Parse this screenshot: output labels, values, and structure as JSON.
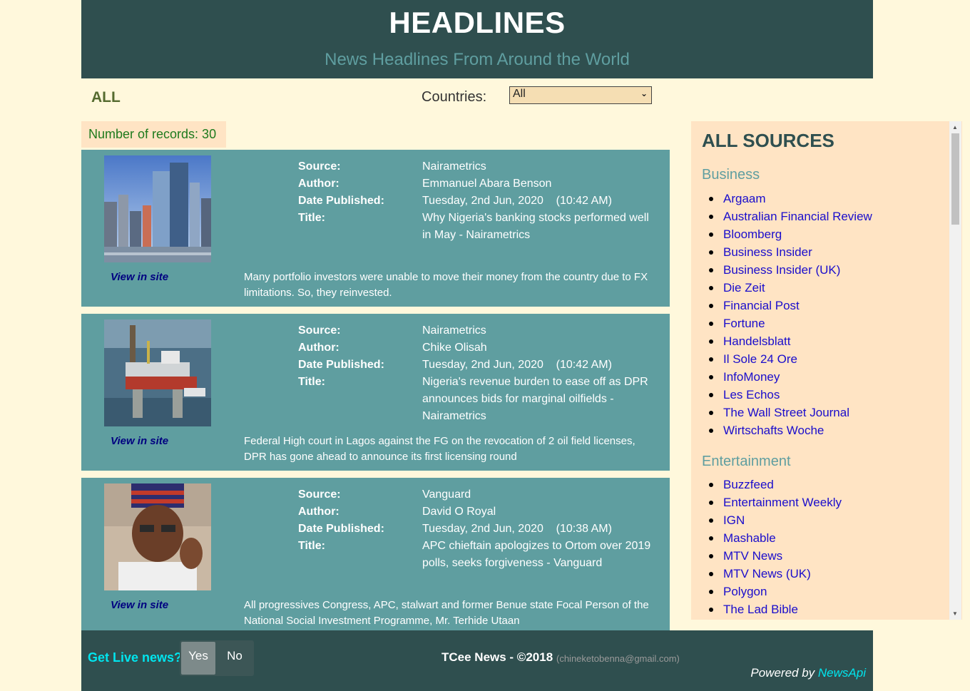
{
  "header": {
    "title": "HEADLINES",
    "subtitle": "News Headlines From Around the World"
  },
  "filter": {
    "category_label": "ALL",
    "countries_label": "Countries:",
    "countries_selected": "All"
  },
  "records": {
    "label": "Number of records: 30"
  },
  "field_labels": {
    "source": "Source:",
    "author": "Author:",
    "date": "Date Published:",
    "title": "Title:",
    "view": "View in site"
  },
  "articles": [
    {
      "source": "Nairametrics",
      "author": "Emmanuel Abara Benson",
      "date": "Tuesday, 2nd Jun, 2020    (10:42 AM)",
      "title": "Why Nigeria's banking stocks performed well in May - Nairametrics",
      "description": "Many portfolio investors were unable to move their money from the country due to FX limitations. So, they reinvested."
    },
    {
      "source": "Nairametrics",
      "author": "Chike Olisah",
      "date": "Tuesday, 2nd Jun, 2020    (10:42 AM)",
      "title": "Nigeria's revenue burden to ease off as DPR announces bids for marginal oilfields - Nairametrics",
      "description": "Federal High court in Lagos against the FG on the revocation of 2 oil field licenses, DPR has gone ahead to announce its first licensing round"
    },
    {
      "source": "Vanguard",
      "author": "David O Royal",
      "date": "Tuesday, 2nd Jun, 2020    (10:38 AM)",
      "title": "APC chieftain apologizes to Ortom over 2019 polls, seeks forgiveness - Vanguard",
      "description": "All progressives Congress, APC, stalwart and former Benue state Focal Person of the National Social Investment Programme, Mr. Terhide Utaan"
    }
  ],
  "sidebar": {
    "heading": "ALL SOURCES",
    "business_heading": "Business",
    "business": [
      "Argaam",
      "Australian Financial Review",
      "Bloomberg",
      "Business Insider",
      "Business Insider (UK)",
      "Die Zeit",
      "Financial Post",
      "Fortune",
      "Handelsblatt",
      "Il Sole 24 Ore",
      "InfoMoney",
      "Les Echos",
      "The Wall Street Journal",
      "Wirtschafts Woche"
    ],
    "entertainment_heading": "Entertainment",
    "entertainment": [
      "Buzzfeed",
      "Entertainment Weekly",
      "IGN",
      "Mashable",
      "MTV News",
      "MTV News (UK)",
      "Polygon",
      "The Lad Bible"
    ]
  },
  "footer": {
    "live_label": "Get Live news?",
    "yes": "Yes",
    "no": "No",
    "brand": "TCee News - ©2018",
    "email": "(chineketobenna@gmail.com)",
    "powered_prefix": "Powered by",
    "powered_api": "NewsApi"
  },
  "colors": {
    "header_bg": "#2f4f4f",
    "article_bg": "#5f9ea0",
    "sidebar_bg": "#ffe4c4",
    "page_bg": "#fff8dc",
    "link": "#1a0dcc",
    "accent": "#00e5ee"
  }
}
